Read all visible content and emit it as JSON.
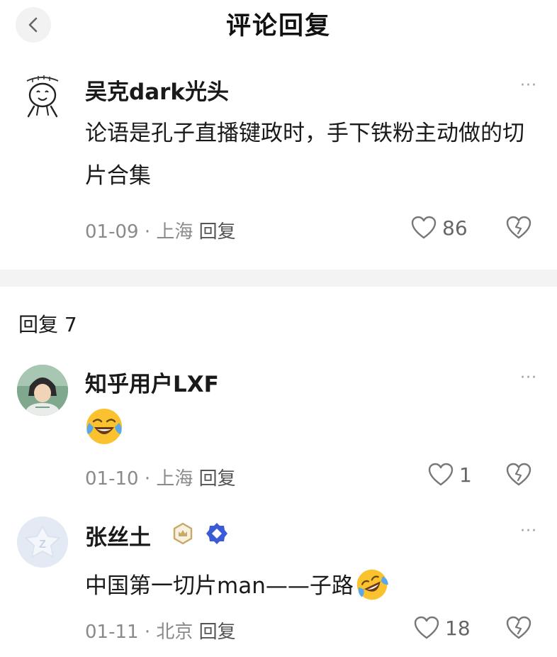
{
  "header": {
    "title": "评论回复",
    "back_icon": "chevron-left-icon"
  },
  "main_comment": {
    "username": "吴克dark光头",
    "text": "论语是孔子直播键政时，手下铁粉主动做的切片合集",
    "date": "01-09",
    "separator": "·",
    "location": "上海",
    "reply_label": "回复",
    "likes": "86",
    "more": "···"
  },
  "replies_header": "回复 7",
  "replies": [
    {
      "username": "知乎用户LXF",
      "emoji": "laughing-crying-emoji",
      "date": "01-10",
      "separator": "·",
      "location": "上海",
      "reply_label": "回复",
      "likes": "1",
      "more": "···"
    },
    {
      "username": "张丝土",
      "text": "中国第一切片man——子路",
      "emoji": "rofl-emoji",
      "date": "01-11",
      "separator": "·",
      "location": "北京",
      "reply_label": "回复",
      "likes": "18",
      "more": "···"
    }
  ],
  "colors": {
    "text_primary": "#1a1a1a",
    "text_secondary": "#8a8a8a",
    "divider": "#f3f3f3",
    "badge_gold": "#c9a96a",
    "badge_blue": "#3b5bd6"
  }
}
